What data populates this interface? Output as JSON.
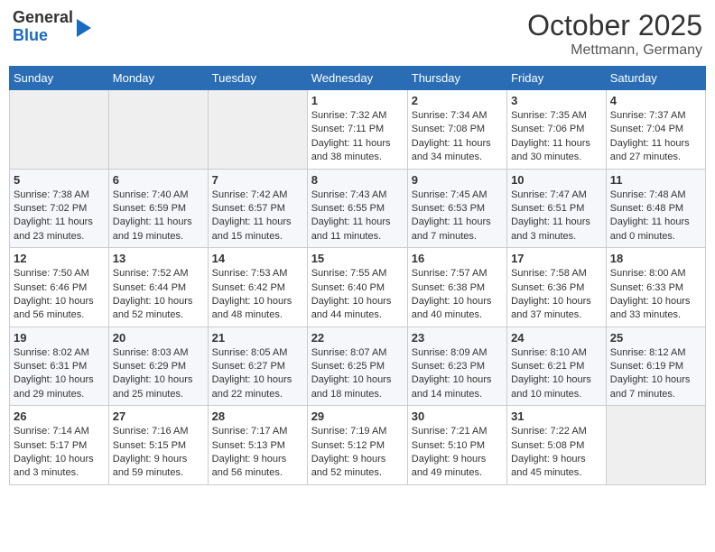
{
  "header": {
    "logo_line1": "General",
    "logo_line2": "Blue",
    "month_year": "October 2025",
    "location": "Mettmann, Germany"
  },
  "days_of_week": [
    "Sunday",
    "Monday",
    "Tuesday",
    "Wednesday",
    "Thursday",
    "Friday",
    "Saturday"
  ],
  "weeks": [
    [
      {
        "num": "",
        "info": ""
      },
      {
        "num": "",
        "info": ""
      },
      {
        "num": "",
        "info": ""
      },
      {
        "num": "1",
        "info": "Sunrise: 7:32 AM\nSunset: 7:11 PM\nDaylight: 11 hours\nand 38 minutes."
      },
      {
        "num": "2",
        "info": "Sunrise: 7:34 AM\nSunset: 7:08 PM\nDaylight: 11 hours\nand 34 minutes."
      },
      {
        "num": "3",
        "info": "Sunrise: 7:35 AM\nSunset: 7:06 PM\nDaylight: 11 hours\nand 30 minutes."
      },
      {
        "num": "4",
        "info": "Sunrise: 7:37 AM\nSunset: 7:04 PM\nDaylight: 11 hours\nand 27 minutes."
      }
    ],
    [
      {
        "num": "5",
        "info": "Sunrise: 7:38 AM\nSunset: 7:02 PM\nDaylight: 11 hours\nand 23 minutes."
      },
      {
        "num": "6",
        "info": "Sunrise: 7:40 AM\nSunset: 6:59 PM\nDaylight: 11 hours\nand 19 minutes."
      },
      {
        "num": "7",
        "info": "Sunrise: 7:42 AM\nSunset: 6:57 PM\nDaylight: 11 hours\nand 15 minutes."
      },
      {
        "num": "8",
        "info": "Sunrise: 7:43 AM\nSunset: 6:55 PM\nDaylight: 11 hours\nand 11 minutes."
      },
      {
        "num": "9",
        "info": "Sunrise: 7:45 AM\nSunset: 6:53 PM\nDaylight: 11 hours\nand 7 minutes."
      },
      {
        "num": "10",
        "info": "Sunrise: 7:47 AM\nSunset: 6:51 PM\nDaylight: 11 hours\nand 3 minutes."
      },
      {
        "num": "11",
        "info": "Sunrise: 7:48 AM\nSunset: 6:48 PM\nDaylight: 11 hours\nand 0 minutes."
      }
    ],
    [
      {
        "num": "12",
        "info": "Sunrise: 7:50 AM\nSunset: 6:46 PM\nDaylight: 10 hours\nand 56 minutes."
      },
      {
        "num": "13",
        "info": "Sunrise: 7:52 AM\nSunset: 6:44 PM\nDaylight: 10 hours\nand 52 minutes."
      },
      {
        "num": "14",
        "info": "Sunrise: 7:53 AM\nSunset: 6:42 PM\nDaylight: 10 hours\nand 48 minutes."
      },
      {
        "num": "15",
        "info": "Sunrise: 7:55 AM\nSunset: 6:40 PM\nDaylight: 10 hours\nand 44 minutes."
      },
      {
        "num": "16",
        "info": "Sunrise: 7:57 AM\nSunset: 6:38 PM\nDaylight: 10 hours\nand 40 minutes."
      },
      {
        "num": "17",
        "info": "Sunrise: 7:58 AM\nSunset: 6:36 PM\nDaylight: 10 hours\nand 37 minutes."
      },
      {
        "num": "18",
        "info": "Sunrise: 8:00 AM\nSunset: 6:33 PM\nDaylight: 10 hours\nand 33 minutes."
      }
    ],
    [
      {
        "num": "19",
        "info": "Sunrise: 8:02 AM\nSunset: 6:31 PM\nDaylight: 10 hours\nand 29 minutes."
      },
      {
        "num": "20",
        "info": "Sunrise: 8:03 AM\nSunset: 6:29 PM\nDaylight: 10 hours\nand 25 minutes."
      },
      {
        "num": "21",
        "info": "Sunrise: 8:05 AM\nSunset: 6:27 PM\nDaylight: 10 hours\nand 22 minutes."
      },
      {
        "num": "22",
        "info": "Sunrise: 8:07 AM\nSunset: 6:25 PM\nDaylight: 10 hours\nand 18 minutes."
      },
      {
        "num": "23",
        "info": "Sunrise: 8:09 AM\nSunset: 6:23 PM\nDaylight: 10 hours\nand 14 minutes."
      },
      {
        "num": "24",
        "info": "Sunrise: 8:10 AM\nSunset: 6:21 PM\nDaylight: 10 hours\nand 10 minutes."
      },
      {
        "num": "25",
        "info": "Sunrise: 8:12 AM\nSunset: 6:19 PM\nDaylight: 10 hours\nand 7 minutes."
      }
    ],
    [
      {
        "num": "26",
        "info": "Sunrise: 7:14 AM\nSunset: 5:17 PM\nDaylight: 10 hours\nand 3 minutes."
      },
      {
        "num": "27",
        "info": "Sunrise: 7:16 AM\nSunset: 5:15 PM\nDaylight: 9 hours\nand 59 minutes."
      },
      {
        "num": "28",
        "info": "Sunrise: 7:17 AM\nSunset: 5:13 PM\nDaylight: 9 hours\nand 56 minutes."
      },
      {
        "num": "29",
        "info": "Sunrise: 7:19 AM\nSunset: 5:12 PM\nDaylight: 9 hours\nand 52 minutes."
      },
      {
        "num": "30",
        "info": "Sunrise: 7:21 AM\nSunset: 5:10 PM\nDaylight: 9 hours\nand 49 minutes."
      },
      {
        "num": "31",
        "info": "Sunrise: 7:22 AM\nSunset: 5:08 PM\nDaylight: 9 hours\nand 45 minutes."
      },
      {
        "num": "",
        "info": ""
      }
    ]
  ]
}
